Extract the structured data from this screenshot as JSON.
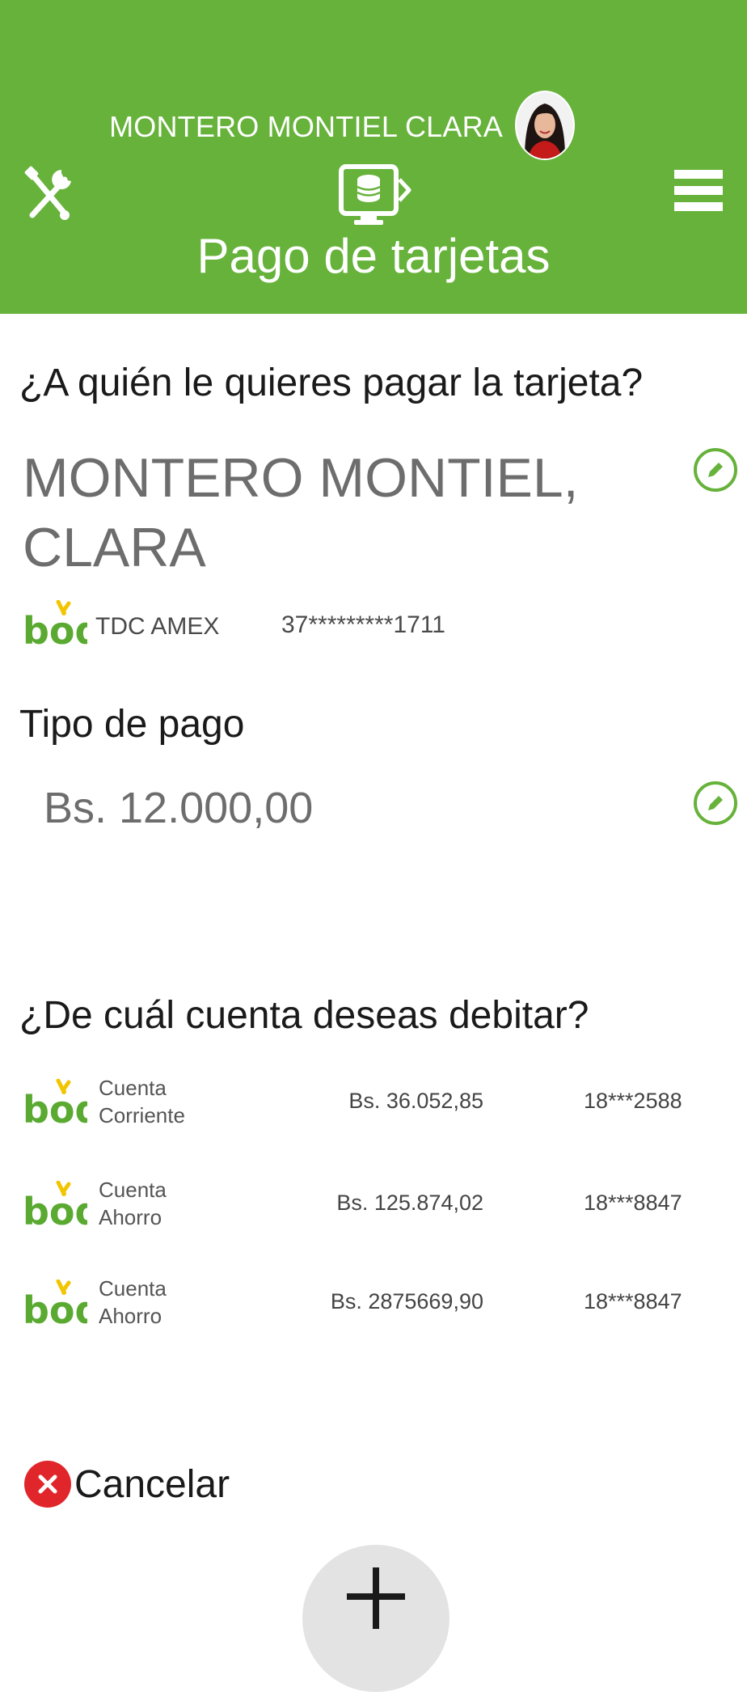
{
  "header": {
    "user_name": "MONTERO MONTIEL CLARA",
    "title": "Pago de tarjetas",
    "background_color": "#66b23a",
    "icons": [
      "tools-icon",
      "transfer-icon",
      "menu-icon",
      "avatar"
    ]
  },
  "payee_section": {
    "question": "¿A quién le quieres pagar la tarjeta?",
    "payee_line1": "MONTERO MONTIEL,",
    "payee_line2": "CLARA",
    "card_type": "TDC AMEX",
    "card_number": "37*********1711"
  },
  "payment_section": {
    "heading": "Tipo de pago",
    "amount": "Bs. 12.000,00"
  },
  "debit_section": {
    "question": "¿De cuál cuenta deseas debitar?",
    "accounts": [
      {
        "type_line1": "Cuenta",
        "type_line2": "Corriente",
        "balance": "Bs. 36.052,85",
        "number": "18***2588"
      },
      {
        "type_line1": "Cuenta",
        "type_line2": "Ahorro",
        "balance": "Bs. 125.874,02",
        "number": "18***8847"
      },
      {
        "type_line1": "Cuenta",
        "type_line2": "Ahorro",
        "balance": "Bs. 2875669,90",
        "number": "18***8847"
      }
    ]
  },
  "actions": {
    "cancel_label": "Cancelar",
    "add_icon": "plus-icon"
  },
  "colors": {
    "brand_green": "#66b23a",
    "cancel_red": "#e0262b",
    "text_gray": "#6d6d6d"
  }
}
